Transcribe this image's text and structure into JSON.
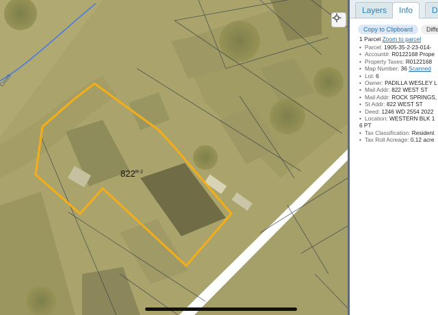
{
  "map": {
    "parcel_label": "822",
    "parcel_sub": "R-2",
    "street_label": "Creek"
  },
  "panel": {
    "tabs": [
      {
        "label": "Layers",
        "active": false
      },
      {
        "label": "Info",
        "active": true
      },
      {
        "label": "Dra",
        "active": false
      }
    ],
    "buttons": {
      "copy": "Copy to Clipboard",
      "differ": "Differ"
    },
    "summary": {
      "count": "1 Parcel",
      "zoom": "Zoom to parcel"
    },
    "attributes": [
      {
        "key": "Parcel:",
        "value": "1905-35-2-23-014-"
      },
      {
        "key": "Account#:",
        "value": "R0122168 Prope"
      },
      {
        "key": "Property Taxes:",
        "value": "R0122168"
      },
      {
        "key": "Map Number:",
        "value": "36",
        "link": "Scanned"
      },
      {
        "key": "Lot:",
        "value": "6"
      },
      {
        "key": "Owner:",
        "value": "PADILLA WESLEY L"
      },
      {
        "key": "Mail Addr:",
        "value": "822 WEST ST"
      },
      {
        "key": "Mail Addr:",
        "value": "ROCK SPRINGS,"
      },
      {
        "key": "St Addr:",
        "value": "822 WEST ST"
      },
      {
        "key": "Deed:",
        "value": "1246 WD 2554 2022"
      },
      {
        "key": "Location:",
        "value": "WESTERN BLK 1",
        "cont": "6 PT"
      },
      {
        "key": "Tax Classification:",
        "value": "Resident"
      },
      {
        "key": "Tax Roll Acreage:",
        "value": "0.12 acre"
      }
    ]
  }
}
